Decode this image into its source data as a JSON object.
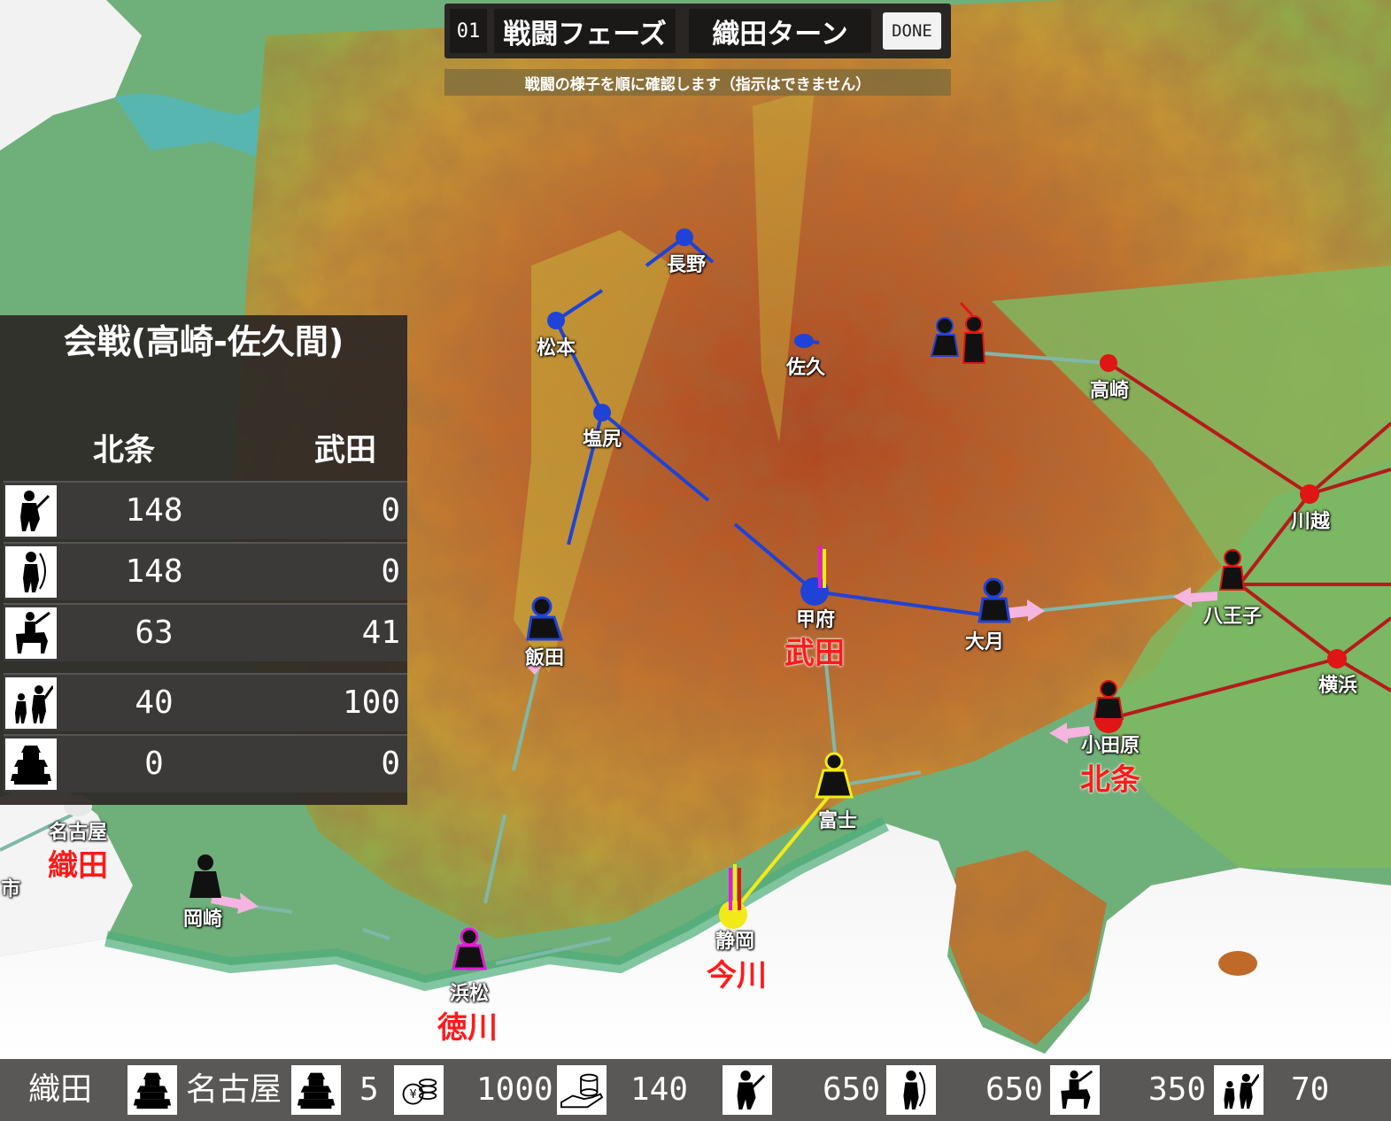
{
  "topbar": {
    "turn": "01",
    "phase": "戦闘フェーズ",
    "player_turn": "織田ターン",
    "done_label": "DONE",
    "subtitle": "戦闘の様子を順に確認します（指示はできません）"
  },
  "battle": {
    "title": "会戦(高崎-佐久間)",
    "left_side": "北条",
    "right_side": "武田",
    "rows": [
      {
        "icon": "infantry-icon",
        "left": "148",
        "right": "0"
      },
      {
        "icon": "archer-icon",
        "left": "148",
        "right": "0"
      },
      {
        "icon": "cavalry-icon",
        "left": "63",
        "right": "41"
      },
      {
        "icon": "gunner-icon",
        "left": "40",
        "right": "100"
      },
      {
        "icon": "castle-icon",
        "left": "0",
        "right": "0"
      }
    ]
  },
  "map": {
    "cities": {
      "nagano": "長野",
      "matsumoto": "松本",
      "saku": "佐久",
      "takasaki": "高崎",
      "shiojiri": "塩尻",
      "kawagoe": "川越",
      "kofu": "甲府",
      "otsuki": "大月",
      "hachioji": "八王子",
      "iida": "飯田",
      "yokohama": "横浜",
      "odawara": "小田原",
      "fuji": "富士",
      "nagoya": "名古屋",
      "okazaki": "岡崎",
      "shizuoka": "静岡",
      "hamamatsu": "浜松",
      "ichi": "市"
    },
    "clans": {
      "takeda": "武田",
      "hojo": "北条",
      "oda": "織田",
      "imagawa": "今川",
      "tokugawa": "徳川"
    },
    "colors": {
      "takeda": "#1f43d6",
      "hojo": "#e01515",
      "imagawa": "#f2ea18",
      "tokugawa": "#e619d6",
      "oda": "#e8e8e8",
      "clan_label": "#ff1a1a"
    }
  },
  "status": {
    "player": "織田",
    "castle_name": "名古屋",
    "castles": "5",
    "gold": "1000",
    "income": "140",
    "infantry": "650",
    "archers": "650",
    "cavalry": "350",
    "gunners": "70"
  }
}
